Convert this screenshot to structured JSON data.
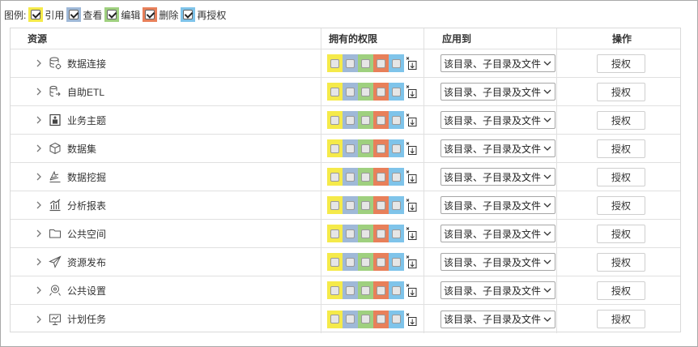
{
  "legend": {
    "label": "图例:",
    "items": [
      {
        "text": "引用",
        "color": "#f5ea4a"
      },
      {
        "text": "查看",
        "color": "#9fb9d8"
      },
      {
        "text": "编辑",
        "color": "#9fd07f"
      },
      {
        "text": "删除",
        "color": "#e8805a"
      },
      {
        "text": "再授权",
        "color": "#7fc4ea"
      }
    ]
  },
  "headers": {
    "resource": "资源",
    "permissions": "拥有的权限",
    "apply_to": "应用到",
    "actions": "操作"
  },
  "apply_option": "该目录、子目录及文件",
  "grant_label": "授权",
  "perm_colors": [
    "#f5ea4a",
    "#9fb9d8",
    "#9fd07f",
    "#e8805a",
    "#7fc4ea"
  ],
  "rows": [
    {
      "name": "数据连接",
      "icon": "database-connection-icon"
    },
    {
      "name": "自助ETL",
      "icon": "self-service-etl-icon"
    },
    {
      "name": "业务主题",
      "icon": "business-theme-icon"
    },
    {
      "name": "数据集",
      "icon": "dataset-cube-icon"
    },
    {
      "name": "数据挖掘",
      "icon": "data-mining-icon"
    },
    {
      "name": "分析报表",
      "icon": "analysis-report-icon"
    },
    {
      "name": "公共空间",
      "icon": "folder-icon"
    },
    {
      "name": "资源发布",
      "icon": "publish-plane-icon"
    },
    {
      "name": "公共设置",
      "icon": "public-settings-icon"
    },
    {
      "name": "计划任务",
      "icon": "scheduled-task-icon"
    }
  ]
}
